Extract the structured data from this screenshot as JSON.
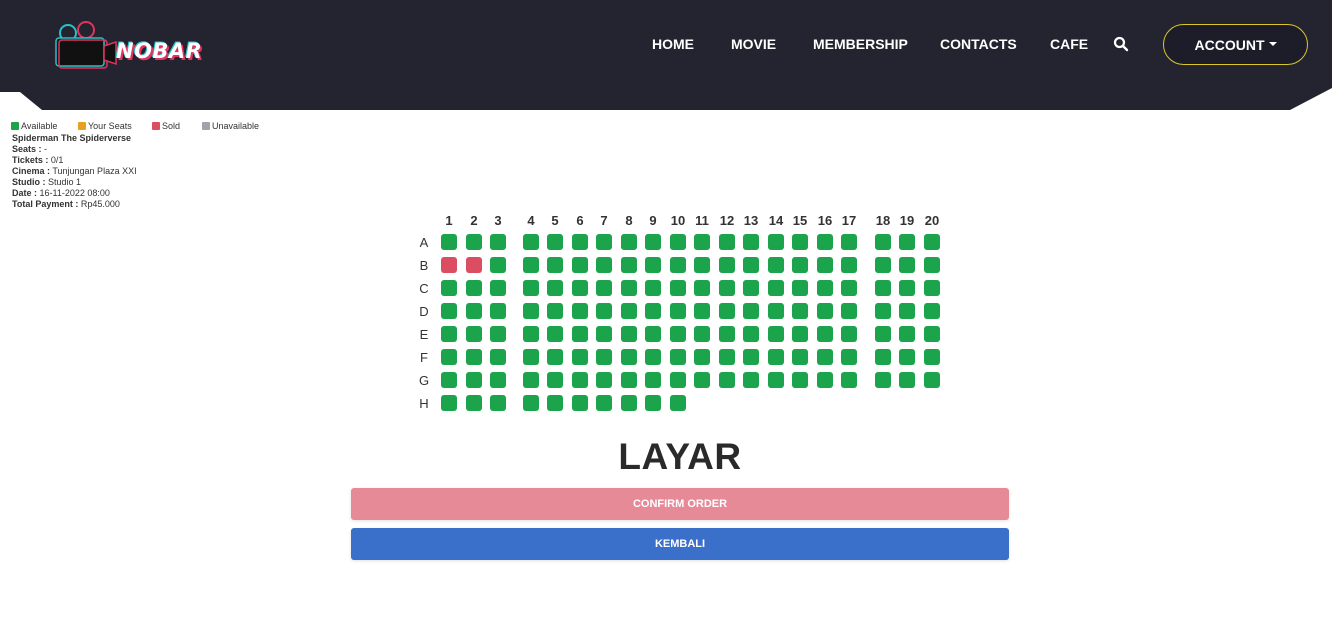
{
  "header": {
    "brand": "NOBAR",
    "nav": [
      "HOME",
      "MOVIE",
      "MEMBERSHIP",
      "CONTACTS",
      "CAFE"
    ],
    "account_label": "ACCOUNT",
    "bg_color": "#23242f"
  },
  "legend": [
    {
      "label": "Available",
      "color": "#1ba44c"
    },
    {
      "label": "Your Seats",
      "color": "#e8a020"
    },
    {
      "label": "Sold",
      "color": "#db4d61"
    },
    {
      "label": "Unavailable",
      "color": "#a0a3ab"
    }
  ],
  "booking": {
    "movie": "Spiderman The Spiderverse",
    "seats_label": "Seats :",
    "seats_value": "-",
    "tickets_label": "Tickets :",
    "tickets_value": "0/1",
    "cinema_label": "Cinema :",
    "cinema_value": "Tunjungan Plaza XXI",
    "studio_label": "Studio :",
    "studio_value": "Studio 1",
    "date_label": "Date :",
    "date_value": "16-11-2022 08:00",
    "payment_label": "Total Payment :",
    "payment_value": "Rp45.000"
  },
  "seat_map": {
    "columns": [
      "1",
      "2",
      "3",
      "4",
      "5",
      "6",
      "7",
      "8",
      "9",
      "10",
      "11",
      "12",
      "13",
      "14",
      "15",
      "16",
      "17",
      "18",
      "19",
      "20"
    ],
    "rows": [
      {
        "label": "A",
        "count": 20,
        "sold": []
      },
      {
        "label": "B",
        "count": 20,
        "sold": [
          1,
          2
        ]
      },
      {
        "label": "C",
        "count": 20,
        "sold": []
      },
      {
        "label": "D",
        "count": 20,
        "sold": []
      },
      {
        "label": "E",
        "count": 20,
        "sold": []
      },
      {
        "label": "F",
        "count": 20,
        "sold": []
      },
      {
        "label": "G",
        "count": 20,
        "sold": []
      },
      {
        "label": "H",
        "count": 10,
        "sold": []
      }
    ]
  },
  "screen_label": "LAYAR",
  "buttons": {
    "confirm": "CONFIRM ORDER",
    "back": "KEMBALI"
  }
}
